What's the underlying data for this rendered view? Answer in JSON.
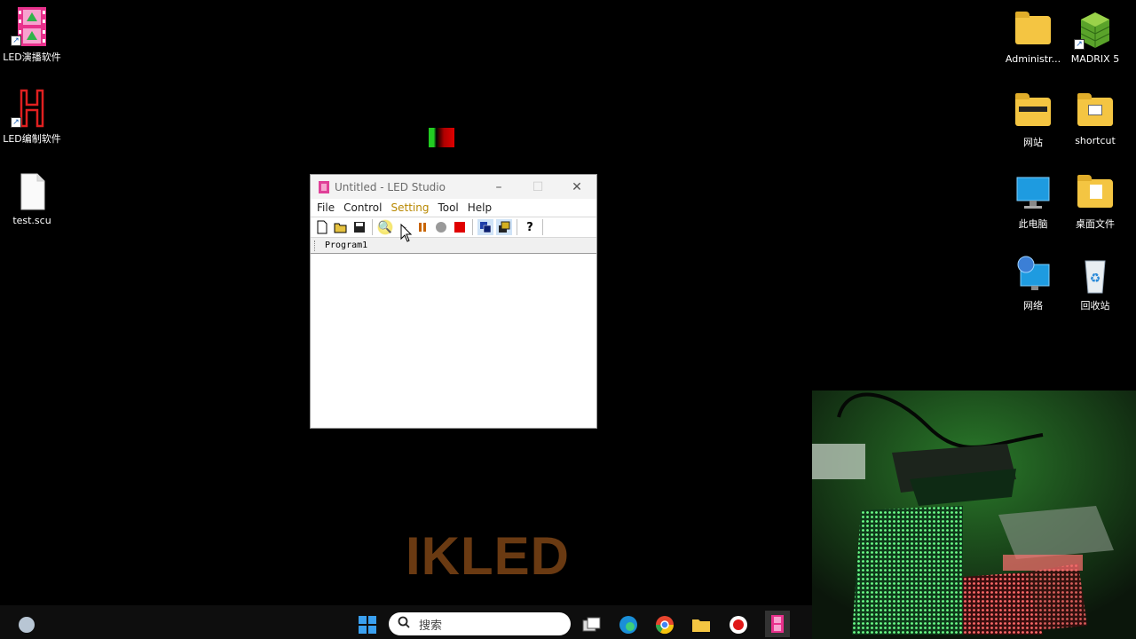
{
  "desktop_left": [
    {
      "label": "LED演播软件",
      "icon": "film-icon"
    },
    {
      "label": "LED编制软件",
      "icon": "h-logo-icon"
    },
    {
      "label": "test.scu",
      "icon": "file-icon"
    }
  ],
  "desktop_right": [
    {
      "label": "Administr...",
      "icon": "folder-icon"
    },
    {
      "label": "MADRIX 5",
      "icon": "madrix-icon"
    },
    {
      "label": "网站",
      "icon": "folder-icon"
    },
    {
      "label": "shortcut",
      "icon": "folder-icon"
    },
    {
      "label": "此电脑",
      "icon": "monitor-icon"
    },
    {
      "label": "桌面文件",
      "icon": "folder-icon"
    },
    {
      "label": "网络",
      "icon": "network-icon"
    },
    {
      "label": "回收站",
      "icon": "recycle-bin-icon"
    }
  ],
  "window": {
    "title": "Untitled - LED Studio",
    "menu": [
      "File",
      "Control",
      "Setting",
      "Tool",
      "Help"
    ],
    "tab": "Program1"
  },
  "taskbar": {
    "search_label": "搜索"
  },
  "watermark": "IKLED",
  "colors": {
    "accent_pink": "#e04098",
    "watermark": "#6a3a12",
    "menu_highlight": "#b88800"
  }
}
